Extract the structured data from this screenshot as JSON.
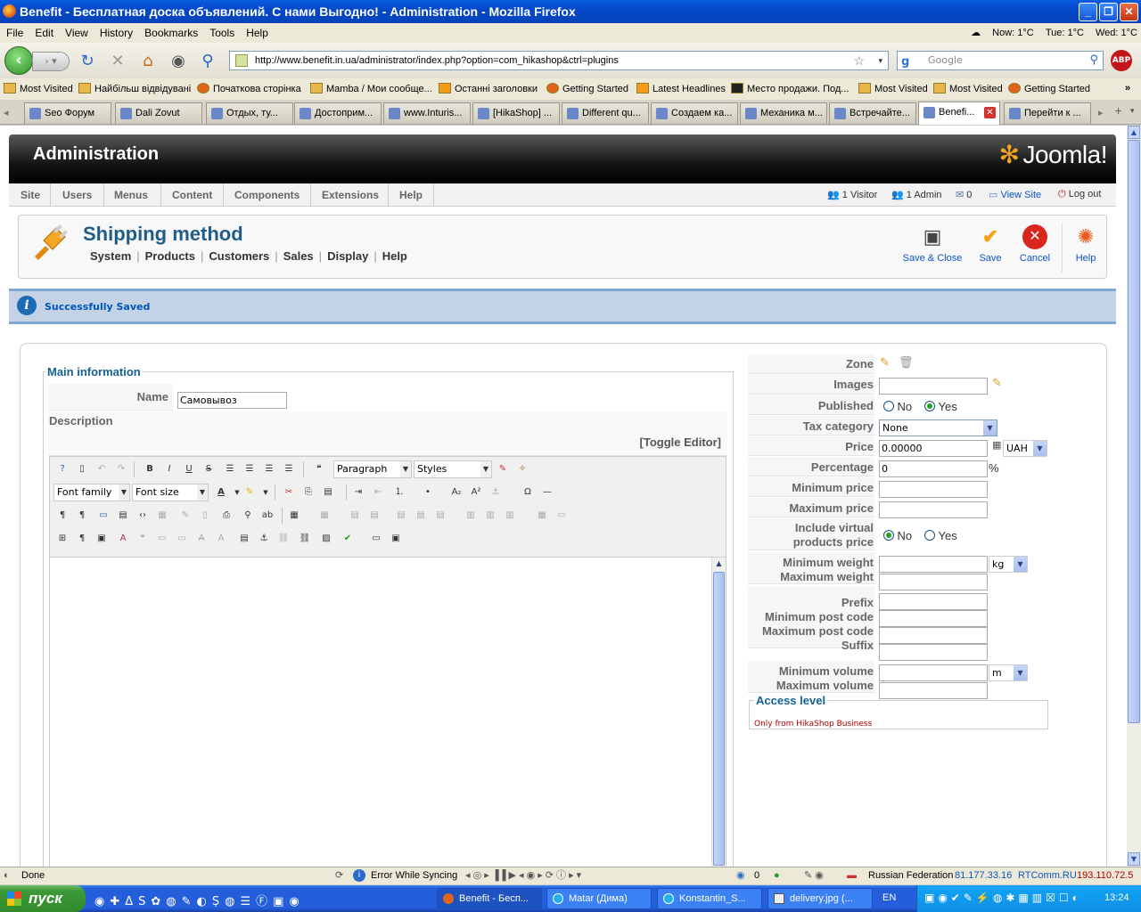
{
  "window": {
    "title": "Benefit - Бесплатная доска объявлений. С нами Выгодно! - Administration - Mozilla Firefox"
  },
  "menubar": {
    "items": [
      "File",
      "Edit",
      "View",
      "History",
      "Bookmarks",
      "Tools",
      "Help"
    ],
    "weather": [
      "Now: 1°C",
      "Tue: 1°C",
      "Wed: 1°C"
    ]
  },
  "navbar": {
    "url": "http://www.benefit.in.ua/administrator/index.php?option=com_hikashop&ctrl=plugins",
    "search_placeholder": "Google",
    "adblock": "ABP"
  },
  "bookmarks": [
    "Most Visited",
    "Найбільш відвідувані",
    "Початкова сторінка",
    "Mamba / Мои сообще...",
    "Останні заголовки",
    "Getting Started",
    "Latest Headlines",
    "Место продажи. Под...",
    "Most Visited",
    "Most Visited",
    "Getting Started"
  ],
  "tabs": [
    {
      "label": "Seo Форум"
    },
    {
      "label": "Dali Zovut"
    },
    {
      "label": "Отдых, ту..."
    },
    {
      "label": "Достоприм..."
    },
    {
      "label": "www.Inturis..."
    },
    {
      "label": "[HikaShop] ..."
    },
    {
      "label": "Different qu..."
    },
    {
      "label": "Создаем ка..."
    },
    {
      "label": "Механика м..."
    },
    {
      "label": "Встречайте..."
    },
    {
      "label": "Benefi..."
    },
    {
      "label": "Перейти к ..."
    }
  ],
  "joomla": {
    "header_title": "Administration",
    "logo_text": "Joomla!",
    "menu": [
      "Site",
      "Users",
      "Menus",
      "Content",
      "Components",
      "Extensions",
      "Help"
    ],
    "status": {
      "visitors": "1 Visitor",
      "admins": "1 Admin",
      "messages": "0",
      "view_site": "View Site",
      "logout": "Log out"
    }
  },
  "toolbar": {
    "page_title": "Shipping method",
    "submenu": [
      "System",
      "Products",
      "Customers",
      "Sales",
      "Display",
      "Help"
    ],
    "buttons": {
      "save_close": "Save & Close",
      "save": "Save",
      "cancel": "Cancel",
      "help": "Help"
    }
  },
  "message": "Successfully Saved",
  "form": {
    "legend": "Main information",
    "name_label": "Name",
    "name_value": "Самовывоз",
    "description_label": "Description",
    "toggle_editor": "[Toggle Editor]",
    "editor": {
      "format": "Paragraph",
      "styles": "Styles",
      "font_family": "Font family",
      "font_size": "Font size"
    }
  },
  "right": {
    "zone": "Zone",
    "images": "Images",
    "published": "Published",
    "published_options": [
      "No",
      "Yes"
    ],
    "published_selected": "Yes",
    "tax_category": "Tax category",
    "tax_value": "None",
    "price": "Price",
    "price_value": "0.00000",
    "currency": "UAH",
    "percentage": "Percentage",
    "percentage_value": "0",
    "percent_sign": "%",
    "min_price": "Minimum price",
    "max_price": "Maximum price",
    "include_virtual_1": "Include virtual",
    "include_virtual_2": "products price",
    "virtual_options": [
      "No",
      "Yes"
    ],
    "virtual_selected": "No",
    "min_weight": "Minimum weight",
    "max_weight": "Maximum weight",
    "weight_unit": "kg",
    "prefix": "Prefix",
    "min_post": "Minimum post code",
    "max_post": "Maximum post code",
    "suffix": "Suffix",
    "min_volume": "Minimum volume",
    "max_volume": "Maximum volume",
    "volume_unit": "m",
    "access_legend": "Access level",
    "access_note": "Only from HikaShop Business"
  },
  "statusbar": {
    "status": "Done",
    "sync": "Error While Syncing",
    "count": "0",
    "country": "Russian Federation",
    "ip1": "81.177.33.16",
    "isp": "RTComm.RU",
    "ip2": "193.110.72.5"
  },
  "taskbar": {
    "start": "пуск",
    "items": [
      "Benefit - Бесп...",
      "Matar (Дима)",
      "Konstantin_S...",
      "delivery.jpg (..."
    ],
    "lang": "EN",
    "clock": "13:24"
  },
  "colors": {
    "joomla_blue": "#146295",
    "link": "#0b55c4",
    "access_note": "#b20000"
  }
}
